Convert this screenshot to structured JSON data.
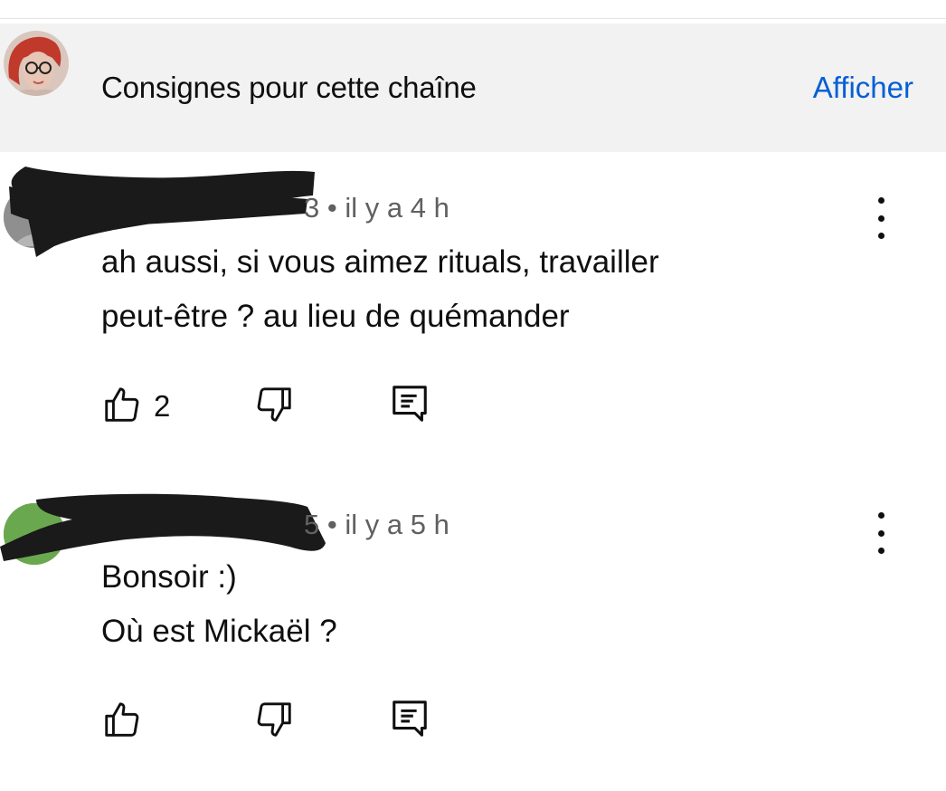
{
  "guidelines": {
    "title": "Consignes pour cette chaîne",
    "show_label": "Afficher",
    "link_color": "#065fd4",
    "background": "#f2f2f2"
  },
  "comments": [
    {
      "author_visible_fragment": "3",
      "separator": "•",
      "time": "il y a 4 h",
      "lines": [
        "ah aussi, si vous aimez rituals, travailler",
        "peut-être ? au lieu de quémander"
      ],
      "like_count": "2",
      "icons": [
        "thumb-up-icon",
        "thumb-down-icon",
        "reply-icon",
        "more-vert-icon"
      ]
    },
    {
      "author_visible_fragment": "5",
      "separator": "•",
      "time": "il y a 5 h",
      "lines": [
        "Bonsoir :)",
        "Où est Mickaël ?"
      ],
      "like_count": "",
      "avatar_color": "#6aa84f",
      "icons": [
        "thumb-up-icon",
        "thumb-down-icon",
        "reply-icon",
        "more-vert-icon"
      ]
    }
  ],
  "colors": {
    "text_primary": "#0f0f0f",
    "text_secondary": "#606060",
    "redaction": "#1a1a1a"
  }
}
